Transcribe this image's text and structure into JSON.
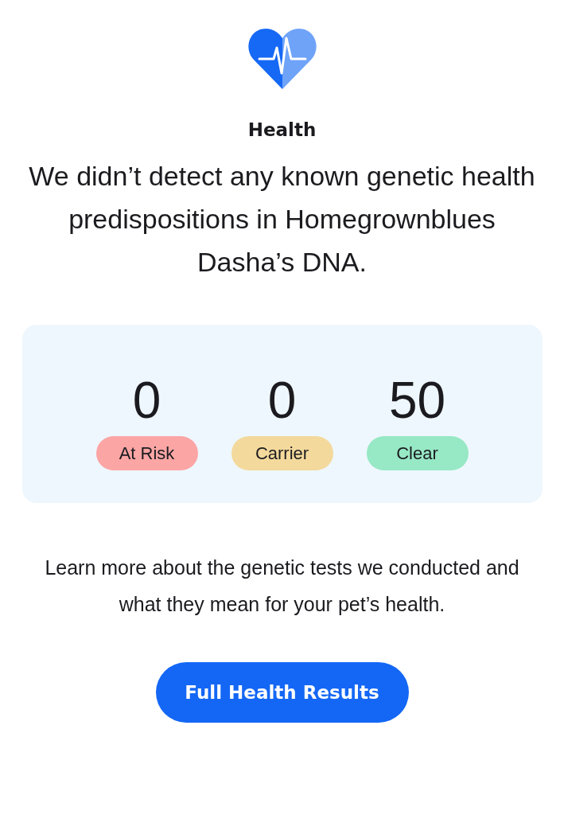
{
  "section": {
    "title": "Health",
    "headline": "We didn’t detect any known genetic health predispositions in Homegrownblues Dasha’s DNA."
  },
  "summary": [
    {
      "count": "0",
      "label": "At Risk",
      "color": "#fca5a5"
    },
    {
      "count": "0",
      "label": "Carrier",
      "color": "#f3d99c"
    },
    {
      "count": "50",
      "label": "Clear",
      "color": "#97e8c5"
    }
  ],
  "description": "Learn more about the genetic tests we conducted and what they mean for your pet’s health.",
  "button": {
    "label": "Full Health Results"
  }
}
